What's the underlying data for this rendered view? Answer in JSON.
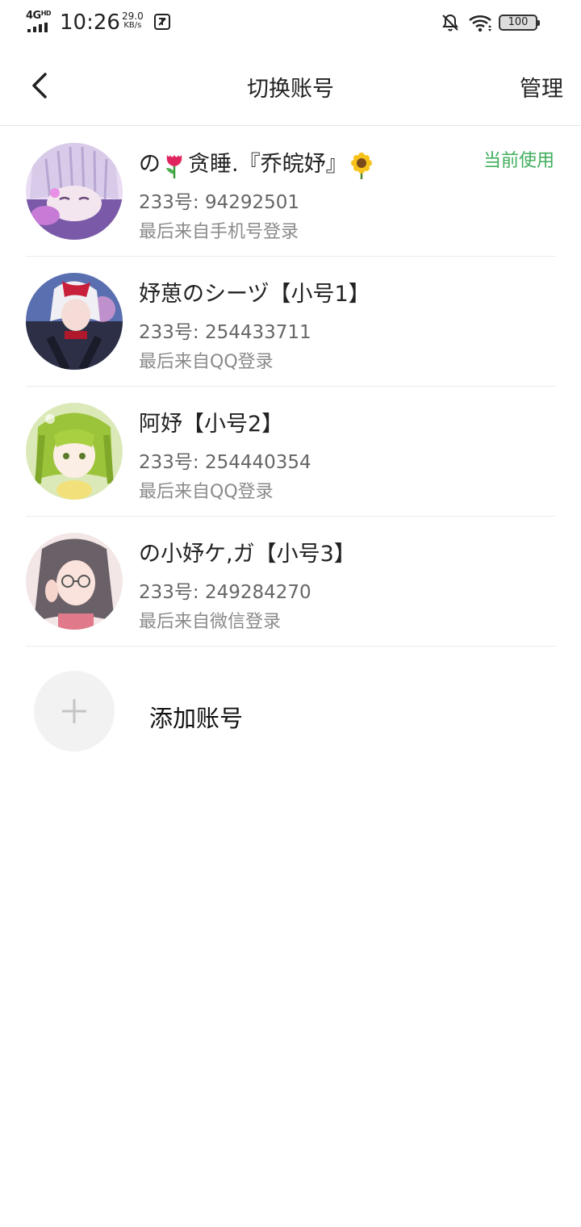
{
  "status_bar": {
    "network": "4G",
    "network_sup": "HD",
    "time": "10:26",
    "speed_value": "29.0",
    "speed_unit": "KB/s",
    "battery": "100"
  },
  "header": {
    "title": "切换账号",
    "manage_label": "管理"
  },
  "accounts": [
    {
      "name_prefix": "の",
      "name_middle": "贪睡.『乔皖妤』",
      "id_text": "233号: 94292501",
      "login_text": "最后来自手机号登录",
      "badge": "当前使用"
    },
    {
      "name": "妤葸のシーヅ【小号1】",
      "id_text": "233号: 254433711",
      "login_text": "最后来自QQ登录"
    },
    {
      "name": "阿妤【小号2】",
      "id_text": "233号: 254440354",
      "login_text": "最后来自QQ登录"
    },
    {
      "name": "の小妤ケ,ガ【小号3】",
      "id_text": "233号: 249284270",
      "login_text": "最后来自微信登录"
    }
  ],
  "add_account_label": "添加账号",
  "colors": {
    "accent_green": "#3fae5c"
  },
  "icons": [
    "back-icon",
    "plus-icon",
    "tulip-emoji",
    "sunflower-emoji",
    "bell-off-icon",
    "wifi-icon",
    "battery-icon"
  ]
}
